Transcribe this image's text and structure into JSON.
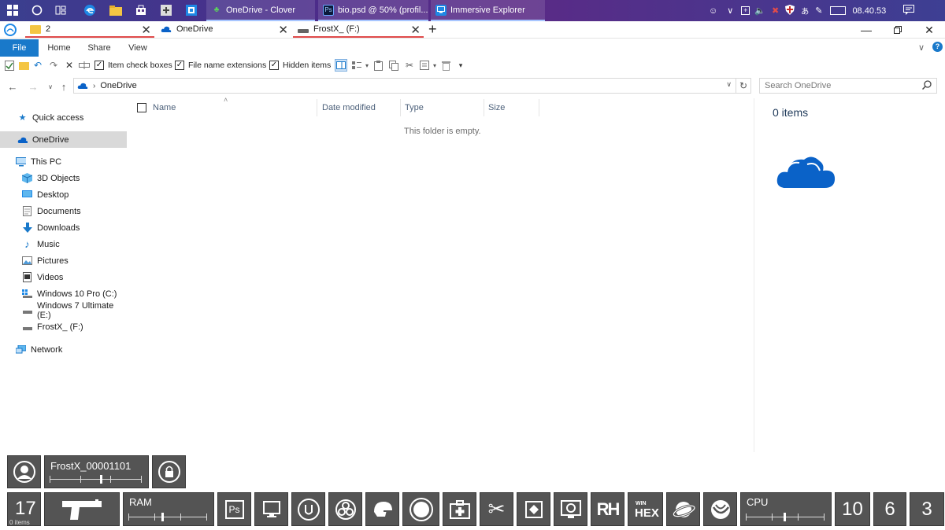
{
  "taskbar": {
    "apps": [
      {
        "label": "OneDrive - Clover"
      },
      {
        "label": "bio.psd @ 50% (profil..."
      },
      {
        "label": "Immersive Explorer"
      }
    ],
    "clock": "08.40.53"
  },
  "tabs": [
    {
      "label": "2"
    },
    {
      "label": "OneDrive"
    },
    {
      "label": "FrostX_ (F:)"
    }
  ],
  "ribbon": {
    "file": "File",
    "home": "Home",
    "share": "Share",
    "view": "View"
  },
  "quickbar": {
    "item_check_boxes": "Item check boxes",
    "file_name_extensions": "File name extensions",
    "hidden_items": "Hidden items"
  },
  "address": {
    "location": "OneDrive",
    "search_placeholder": "Search OneDrive"
  },
  "nav": {
    "quick_access": "Quick access",
    "onedrive": "OneDrive",
    "this_pc": "This PC",
    "children": [
      {
        "label": "3D Objects",
        "icon": "cube-icon"
      },
      {
        "label": "Desktop",
        "icon": "desktop-icon"
      },
      {
        "label": "Documents",
        "icon": "documents-icon"
      },
      {
        "label": "Downloads",
        "icon": "download-icon"
      },
      {
        "label": "Music",
        "icon": "music-icon"
      },
      {
        "label": "Pictures",
        "icon": "pictures-icon"
      },
      {
        "label": "Videos",
        "icon": "videos-icon"
      },
      {
        "label": "Windows 10 Pro (C:)",
        "icon": "drive-icon"
      },
      {
        "label": "Windows 7 Ultimate (E:)",
        "icon": "drive-icon"
      },
      {
        "label": "FrostX_ (F:)",
        "icon": "drive-icon"
      }
    ],
    "network": "Network"
  },
  "filelist": {
    "columns": [
      "Name",
      "Date modified",
      "Type",
      "Size"
    ],
    "empty_text": "This folder is empty."
  },
  "preview": {
    "count": "0 items"
  },
  "overlay": {
    "user_name": "FrostX_00001101",
    "count_big": "17",
    "count_small": "0 items",
    "ram_label": "RAM",
    "ps_label": "Ps",
    "rh_label": "RH",
    "win_label": "WIN",
    "hex_label": "HEX",
    "cpu_label": "CPU",
    "num_a": "10",
    "num_b": "6",
    "num_c": "3",
    "sliders": {
      "user_level": 0.55,
      "ram_level": 0.42,
      "cpu_level": 0.48
    }
  },
  "colors": {
    "accent": "#1979ca",
    "tab_underline": "#e04b4b",
    "onedrive_blue": "#0a62c8",
    "widget_bg": "#545454"
  }
}
